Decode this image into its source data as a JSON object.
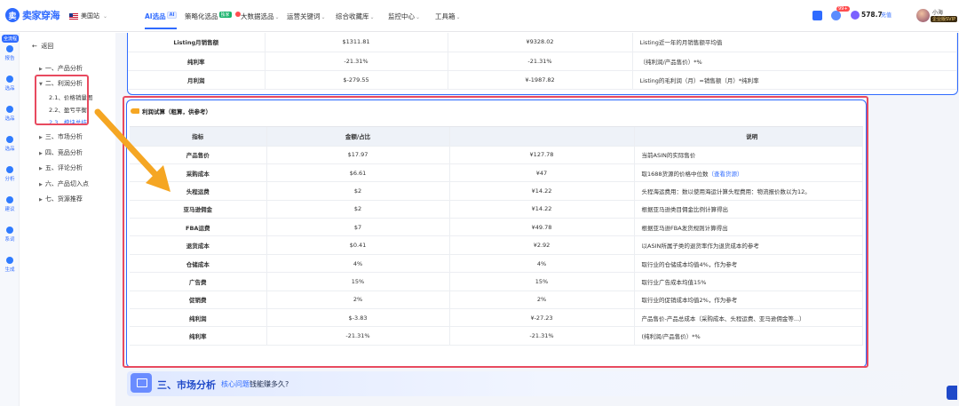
{
  "brand": {
    "logo_text": "卖家穿海"
  },
  "site": {
    "label": "美国站"
  },
  "nav": [
    {
      "label": "AI选品",
      "badge": "AI",
      "active": true
    },
    {
      "label": "策略化选品",
      "badge": "独家"
    },
    {
      "label": "大数据选品",
      "badge": ""
    },
    {
      "label": "运营关键词"
    },
    {
      "label": "综合收藏库"
    },
    {
      "label": "监控中心"
    },
    {
      "label": "工具箱"
    }
  ],
  "user": {
    "points": "578.7",
    "recharge": "充值",
    "name": "小海",
    "vip": "企业版SVIP",
    "msg_count": "99+"
  },
  "rail": {
    "tag": "全流程",
    "items": [
      "报告",
      "选品",
      "选品",
      "选品",
      "分析",
      "建议",
      "系词",
      "生成"
    ]
  },
  "outline": {
    "back": "返回",
    "items": [
      {
        "label": "一、产品分析"
      },
      {
        "label": "二、利润分析"
      },
      {
        "label": "三、市场分析"
      },
      {
        "label": "四、竞品分析"
      },
      {
        "label": "五、评论分析"
      },
      {
        "label": "六、产品切入点"
      },
      {
        "label": "七、货源推荐"
      }
    ],
    "subs": [
      {
        "label": "2.1、价格销量图"
      },
      {
        "label": "2.2、盈亏平衡"
      },
      {
        "label": "2.3、模块总结"
      }
    ]
  },
  "top_table": [
    {
      "name": "Listing月销售额",
      "usd": "$1311.81",
      "cny": "¥9328.02",
      "desc": "Listing近一年的月销售额平均值"
    },
    {
      "name": "纯利率",
      "usd": "-21.31%",
      "cny": "-21.31%",
      "desc": "（纯利润/产品售价）*%"
    },
    {
      "name": "月利润",
      "usd": "$-279.55",
      "cny": "¥-1987.82",
      "desc": "Listing的毛利润（月）=销售额（月）*纯利率"
    }
  ],
  "calc": {
    "title": "利润试算（粗算，供参考）",
    "headers": [
      "指标",
      "金额/占比",
      "",
      "说明"
    ],
    "rows": [
      {
        "name": "产品售价",
        "usd": "$17.97",
        "cny": "¥127.78",
        "desc": "当前ASIN的实际售价",
        "link": ""
      },
      {
        "name": "采购成本",
        "usd": "$6.61",
        "cny": "¥47",
        "desc": "取1688货源的价格中位数",
        "link": "（查看货源）"
      },
      {
        "name": "头程运费",
        "usd": "$2",
        "cny": "¥14.22",
        "desc": "头程海运费用：数以使用海运计算头程费用：物流报价数以为12。",
        "link": ""
      },
      {
        "name": "亚马逊佣金",
        "usd": "$2",
        "cny": "¥14.22",
        "desc": "根据亚马逊类目佣金比例计算得出",
        "link": ""
      },
      {
        "name": "FBA运费",
        "usd": "$7",
        "cny": "¥49.78",
        "desc": "根据亚马逊FBA发货规则计算得出",
        "link": ""
      },
      {
        "name": "退货成本",
        "usd": "$0.41",
        "cny": "¥2.92",
        "desc": "以ASIN所属子类的退货率作为退货成本的参考",
        "link": ""
      },
      {
        "name": "仓储成本",
        "usd": "4%",
        "cny": "4%",
        "desc": "取行业的仓储成本均值4%，作为参考",
        "link": ""
      },
      {
        "name": "广告费",
        "usd": "15%",
        "cny": "15%",
        "desc": "取行业广告成本均值15%",
        "link": ""
      },
      {
        "name": "促销费",
        "usd": "2%",
        "cny": "2%",
        "desc": "取行业的促销成本均值2%，作为参考",
        "link": ""
      },
      {
        "name": "纯利润",
        "usd": "$-3.83",
        "cny": "¥-27.23",
        "desc": "产品售价-产品总成本（采购成本、头程运费、亚马逊佣金等...）",
        "link": ""
      },
      {
        "name": "纯利率",
        "usd": "-21.31%",
        "cny": "-21.31%",
        "desc": "(纯利润/产品售价）*%",
        "link": ""
      }
    ]
  },
  "section3": {
    "title": "三、市场分析",
    "sub": "核心问题:",
    "question": "钱能赚多久?"
  },
  "colors": {
    "accent": "#2f6bff",
    "highlight": "#e84a5f",
    "arrow": "#f5a623"
  }
}
